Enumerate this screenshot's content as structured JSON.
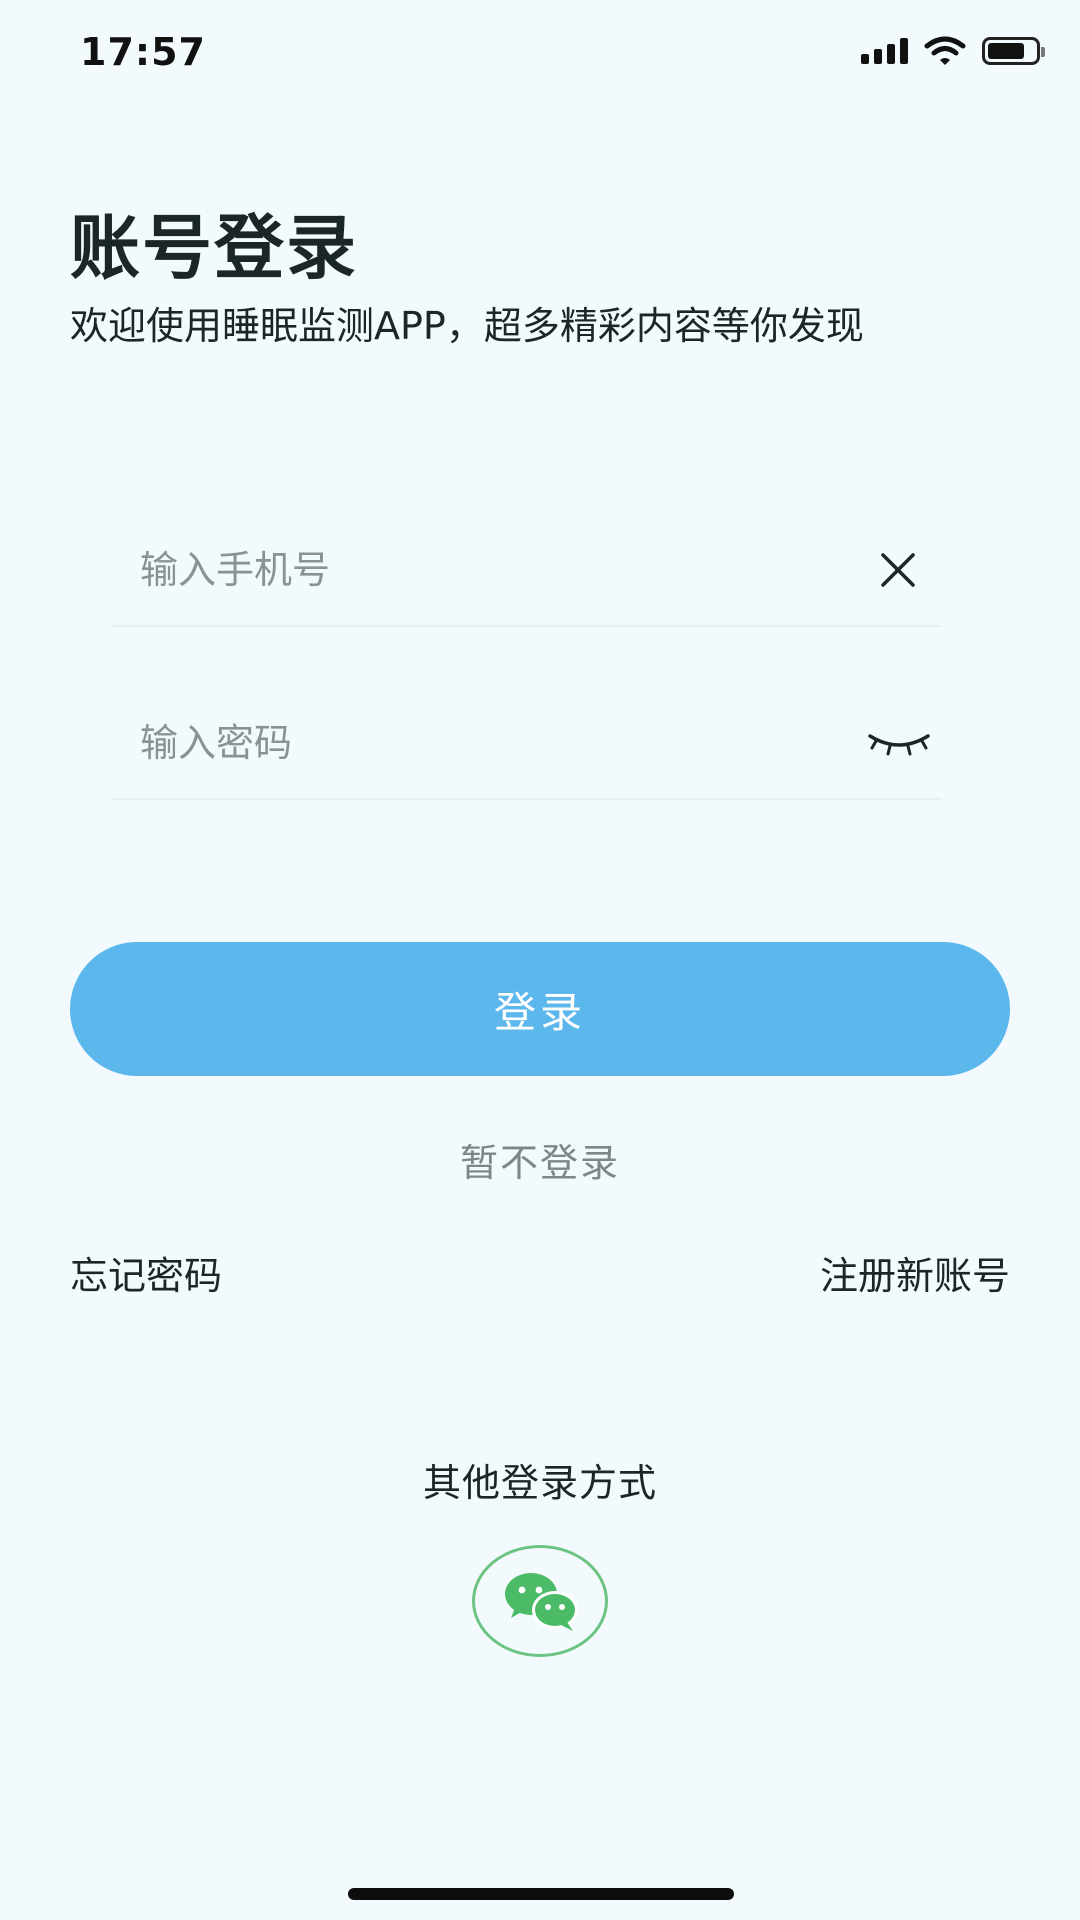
{
  "status_bar": {
    "time": "17:57"
  },
  "header": {
    "title": "账号登录",
    "subtitle": "欢迎使用睡眠监测APP，超多精彩内容等你发现"
  },
  "form": {
    "phone_placeholder": "输入手机号",
    "password_placeholder": "输入密码",
    "phone_value": "",
    "password_value": ""
  },
  "actions": {
    "login_label": "登录",
    "skip_label": "暂不登录",
    "forgot_label": "忘记密码",
    "register_label": "注册新账号"
  },
  "other_login": {
    "label": "其他登录方式",
    "icon": "wechat-icon"
  },
  "colors": {
    "background": "#f3fafd",
    "primary": "#5cb7ec",
    "wechat_green": "#6cc482",
    "muted_text": "#7d8789"
  },
  "icons": {
    "clear": "close-icon",
    "password_toggle": "eye-closed-icon",
    "signal": "cellular-signal-icon",
    "wifi": "wifi-icon",
    "battery": "battery-icon"
  }
}
